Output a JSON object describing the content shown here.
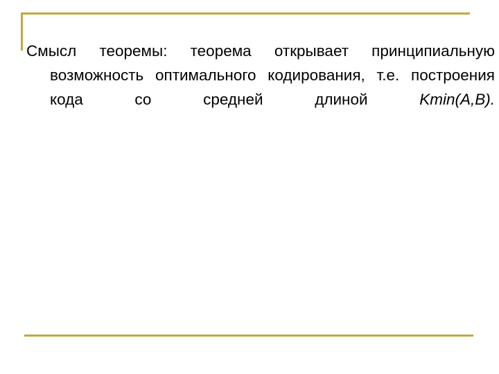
{
  "slide": {
    "background_color": "#ffffff",
    "accent_color": "#bfa93c",
    "text_color": "#000000",
    "body": {
      "lead_text": "Смысл теоремы: теорема открывает принципиальную возможность оптимального кодирования, т.е. построения кода со средней длиной ",
      "formula": "Kmin(A,B).",
      "full_text": "Смысл теоремы: теорема открывает принципиальную возможность оптимального кодирования, т.е. построения кода со средней длиной Kmin(A,B)."
    },
    "decorations": {
      "corner_rule_name": "top-left-corner-rule",
      "bottom_rule_name": "bottom-horizontal-rule"
    }
  }
}
